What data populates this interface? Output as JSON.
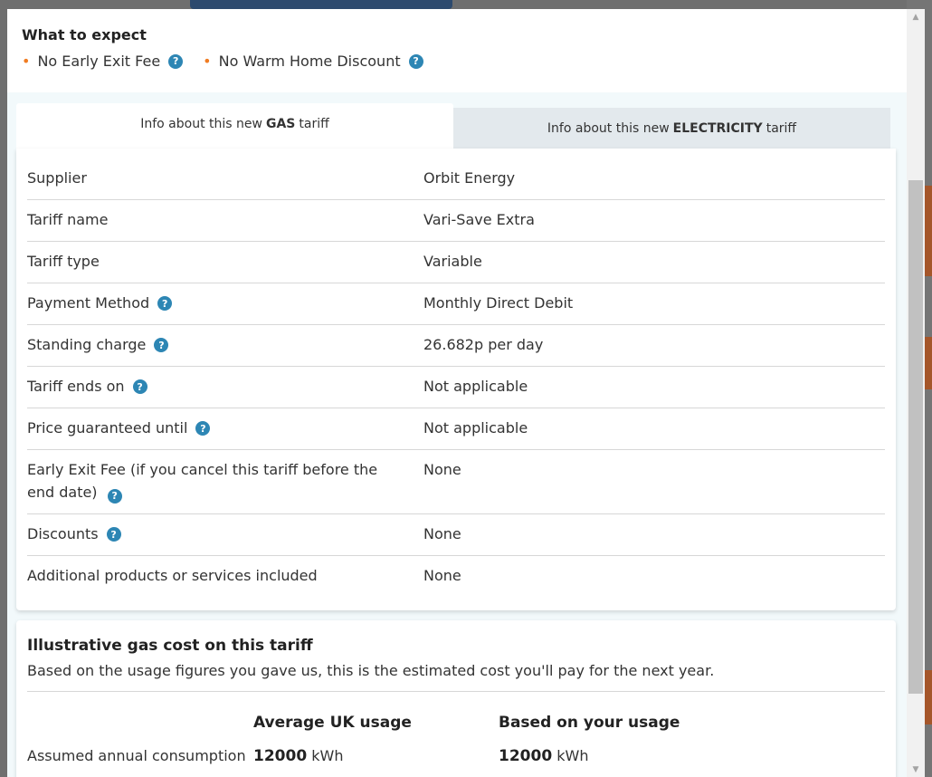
{
  "expect": {
    "title": "What to expect",
    "items": [
      {
        "label": "No Early Exit Fee"
      },
      {
        "label": "No Warm Home Discount"
      }
    ]
  },
  "tabs": {
    "gas": {
      "prefix": "Info about this new",
      "strong": "GAS",
      "suffix": "tariff"
    },
    "electricity": {
      "prefix": "Info about this new",
      "strong": "ELECTRICITY",
      "suffix": "tariff"
    }
  },
  "tariff_rows": [
    {
      "label": "Supplier",
      "value": "Orbit Energy",
      "help": false
    },
    {
      "label": "Tariff name",
      "value": "Vari-Save Extra",
      "help": false
    },
    {
      "label": "Tariff type",
      "value": "Variable",
      "help": false
    },
    {
      "label": "Payment Method",
      "value": "Monthly Direct Debit",
      "help": true
    },
    {
      "label": "Standing charge",
      "value": "26.682p per day",
      "help": true
    },
    {
      "label": "Tariff ends on",
      "value": "Not applicable",
      "help": true
    },
    {
      "label": "Price guaranteed until",
      "value": "Not applicable",
      "help": true
    },
    {
      "label": "Early Exit Fee (if you cancel this tariff before the end date)",
      "value": "None",
      "help": true
    },
    {
      "label": "Discounts",
      "value": "None",
      "help": true
    },
    {
      "label": "Additional products or services included",
      "value": "None",
      "help": false
    }
  ],
  "illustrative": {
    "title": "Illustrative gas cost on this tariff",
    "description": "Based on the usage figures you gave us, this is the estimated cost you'll pay for the next year.",
    "col_avg": "Average UK usage",
    "col_yours": "Based on your usage",
    "row_label": "Assumed annual consumption",
    "avg_value": "12000",
    "your_value": "12000",
    "unit": "kWh"
  },
  "help_glyph": "?",
  "colors": {
    "accent_bullet": "#f07c22",
    "help_icon": "#2d86b4"
  }
}
